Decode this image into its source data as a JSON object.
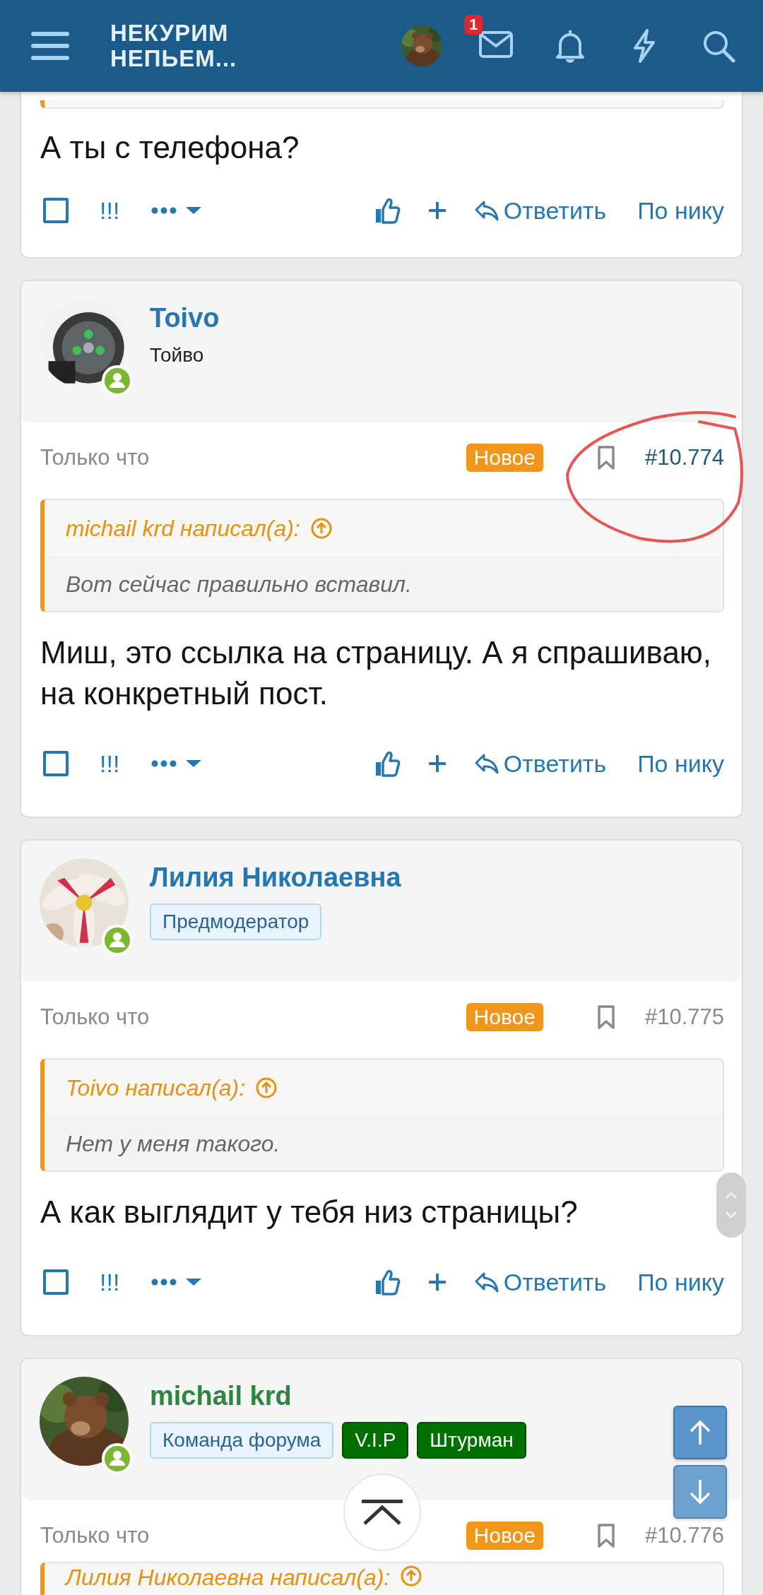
{
  "header": {
    "logo_lines": [
      "НЕКУРИМ",
      "НЕПЬЕМ..."
    ],
    "inbox_badge": "1"
  },
  "posts": [
    {
      "partial": true,
      "quote": {
        "cut": true
      },
      "body": "А ты с телефона?",
      "actions": {
        "checked": false,
        "report": "!!!",
        "reply": "Ответить",
        "by_nick": "По нику"
      }
    },
    {
      "author": {
        "name": "Toivo",
        "color": "#2577b1",
        "online": true,
        "subtitle": "Тойво"
      },
      "time": "Только что",
      "new_label": "Новое",
      "number": "#10.774",
      "number_highlighted": true,
      "annotated": true,
      "quote": {
        "header": "michail krd написал(а):",
        "text": "Вот сейчас правильно вставил."
      },
      "body": "Миш, это ссылка на страницу. А я спрашиваю, на конкретный пост.",
      "actions": {
        "checked": false,
        "report": "!!!",
        "reply": "Ответить",
        "by_nick": "По нику"
      }
    },
    {
      "author": {
        "name": "Лилия Николаевна",
        "color": "#2577b1",
        "online": true,
        "badges": [
          {
            "label": "Предмодератор",
            "kind": "role"
          }
        ]
      },
      "time": "Только что",
      "new_label": "Новое",
      "number": "#10.775",
      "number_highlighted": false,
      "annotated": false,
      "quote": {
        "header": "Toivo написал(а):",
        "text": "Нет у меня такого."
      },
      "body": "А как выглядит у тебя низ страницы?",
      "actions": {
        "checked": false,
        "report": "!!!",
        "reply": "Ответить",
        "by_nick": "По нику"
      }
    },
    {
      "author": {
        "name": "michail krd",
        "color": "#2e8540",
        "online": true,
        "badges": [
          {
            "label": "Команда форума",
            "kind": "role"
          },
          {
            "label": "V.I.P",
            "kind": "group"
          },
          {
            "label": "Штурман",
            "kind": "group"
          }
        ]
      },
      "time": "Только что",
      "new_label": "Новое",
      "number": "#10.776",
      "number_highlighted": false,
      "annotated": false,
      "quote": {
        "header": "Лилия Николаевна написал(а):"
      }
    }
  ]
}
